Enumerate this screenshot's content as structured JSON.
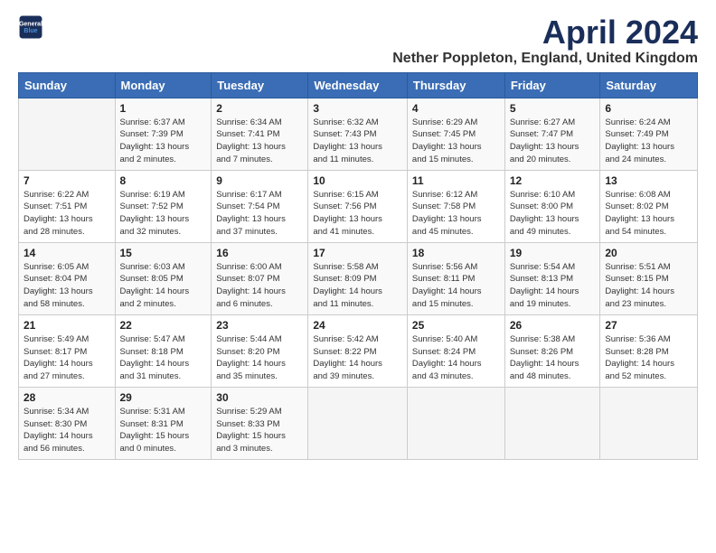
{
  "logo": {
    "line1": "General",
    "line2": "Blue"
  },
  "title": "April 2024",
  "subtitle": "Nether Poppleton, England, United Kingdom",
  "weekdays": [
    "Sunday",
    "Monday",
    "Tuesday",
    "Wednesday",
    "Thursday",
    "Friday",
    "Saturday"
  ],
  "weeks": [
    [
      {
        "day": "",
        "info": ""
      },
      {
        "day": "1",
        "info": "Sunrise: 6:37 AM\nSunset: 7:39 PM\nDaylight: 13 hours\nand 2 minutes."
      },
      {
        "day": "2",
        "info": "Sunrise: 6:34 AM\nSunset: 7:41 PM\nDaylight: 13 hours\nand 7 minutes."
      },
      {
        "day": "3",
        "info": "Sunrise: 6:32 AM\nSunset: 7:43 PM\nDaylight: 13 hours\nand 11 minutes."
      },
      {
        "day": "4",
        "info": "Sunrise: 6:29 AM\nSunset: 7:45 PM\nDaylight: 13 hours\nand 15 minutes."
      },
      {
        "day": "5",
        "info": "Sunrise: 6:27 AM\nSunset: 7:47 PM\nDaylight: 13 hours\nand 20 minutes."
      },
      {
        "day": "6",
        "info": "Sunrise: 6:24 AM\nSunset: 7:49 PM\nDaylight: 13 hours\nand 24 minutes."
      }
    ],
    [
      {
        "day": "7",
        "info": "Sunrise: 6:22 AM\nSunset: 7:51 PM\nDaylight: 13 hours\nand 28 minutes."
      },
      {
        "day": "8",
        "info": "Sunrise: 6:19 AM\nSunset: 7:52 PM\nDaylight: 13 hours\nand 32 minutes."
      },
      {
        "day": "9",
        "info": "Sunrise: 6:17 AM\nSunset: 7:54 PM\nDaylight: 13 hours\nand 37 minutes."
      },
      {
        "day": "10",
        "info": "Sunrise: 6:15 AM\nSunset: 7:56 PM\nDaylight: 13 hours\nand 41 minutes."
      },
      {
        "day": "11",
        "info": "Sunrise: 6:12 AM\nSunset: 7:58 PM\nDaylight: 13 hours\nand 45 minutes."
      },
      {
        "day": "12",
        "info": "Sunrise: 6:10 AM\nSunset: 8:00 PM\nDaylight: 13 hours\nand 49 minutes."
      },
      {
        "day": "13",
        "info": "Sunrise: 6:08 AM\nSunset: 8:02 PM\nDaylight: 13 hours\nand 54 minutes."
      }
    ],
    [
      {
        "day": "14",
        "info": "Sunrise: 6:05 AM\nSunset: 8:04 PM\nDaylight: 13 hours\nand 58 minutes."
      },
      {
        "day": "15",
        "info": "Sunrise: 6:03 AM\nSunset: 8:05 PM\nDaylight: 14 hours\nand 2 minutes."
      },
      {
        "day": "16",
        "info": "Sunrise: 6:00 AM\nSunset: 8:07 PM\nDaylight: 14 hours\nand 6 minutes."
      },
      {
        "day": "17",
        "info": "Sunrise: 5:58 AM\nSunset: 8:09 PM\nDaylight: 14 hours\nand 11 minutes."
      },
      {
        "day": "18",
        "info": "Sunrise: 5:56 AM\nSunset: 8:11 PM\nDaylight: 14 hours\nand 15 minutes."
      },
      {
        "day": "19",
        "info": "Sunrise: 5:54 AM\nSunset: 8:13 PM\nDaylight: 14 hours\nand 19 minutes."
      },
      {
        "day": "20",
        "info": "Sunrise: 5:51 AM\nSunset: 8:15 PM\nDaylight: 14 hours\nand 23 minutes."
      }
    ],
    [
      {
        "day": "21",
        "info": "Sunrise: 5:49 AM\nSunset: 8:17 PM\nDaylight: 14 hours\nand 27 minutes."
      },
      {
        "day": "22",
        "info": "Sunrise: 5:47 AM\nSunset: 8:18 PM\nDaylight: 14 hours\nand 31 minutes."
      },
      {
        "day": "23",
        "info": "Sunrise: 5:44 AM\nSunset: 8:20 PM\nDaylight: 14 hours\nand 35 minutes."
      },
      {
        "day": "24",
        "info": "Sunrise: 5:42 AM\nSunset: 8:22 PM\nDaylight: 14 hours\nand 39 minutes."
      },
      {
        "day": "25",
        "info": "Sunrise: 5:40 AM\nSunset: 8:24 PM\nDaylight: 14 hours\nand 43 minutes."
      },
      {
        "day": "26",
        "info": "Sunrise: 5:38 AM\nSunset: 8:26 PM\nDaylight: 14 hours\nand 48 minutes."
      },
      {
        "day": "27",
        "info": "Sunrise: 5:36 AM\nSunset: 8:28 PM\nDaylight: 14 hours\nand 52 minutes."
      }
    ],
    [
      {
        "day": "28",
        "info": "Sunrise: 5:34 AM\nSunset: 8:30 PM\nDaylight: 14 hours\nand 56 minutes."
      },
      {
        "day": "29",
        "info": "Sunrise: 5:31 AM\nSunset: 8:31 PM\nDaylight: 15 hours\nand 0 minutes."
      },
      {
        "day": "30",
        "info": "Sunrise: 5:29 AM\nSunset: 8:33 PM\nDaylight: 15 hours\nand 3 minutes."
      },
      {
        "day": "",
        "info": ""
      },
      {
        "day": "",
        "info": ""
      },
      {
        "day": "",
        "info": ""
      },
      {
        "day": "",
        "info": ""
      }
    ]
  ]
}
